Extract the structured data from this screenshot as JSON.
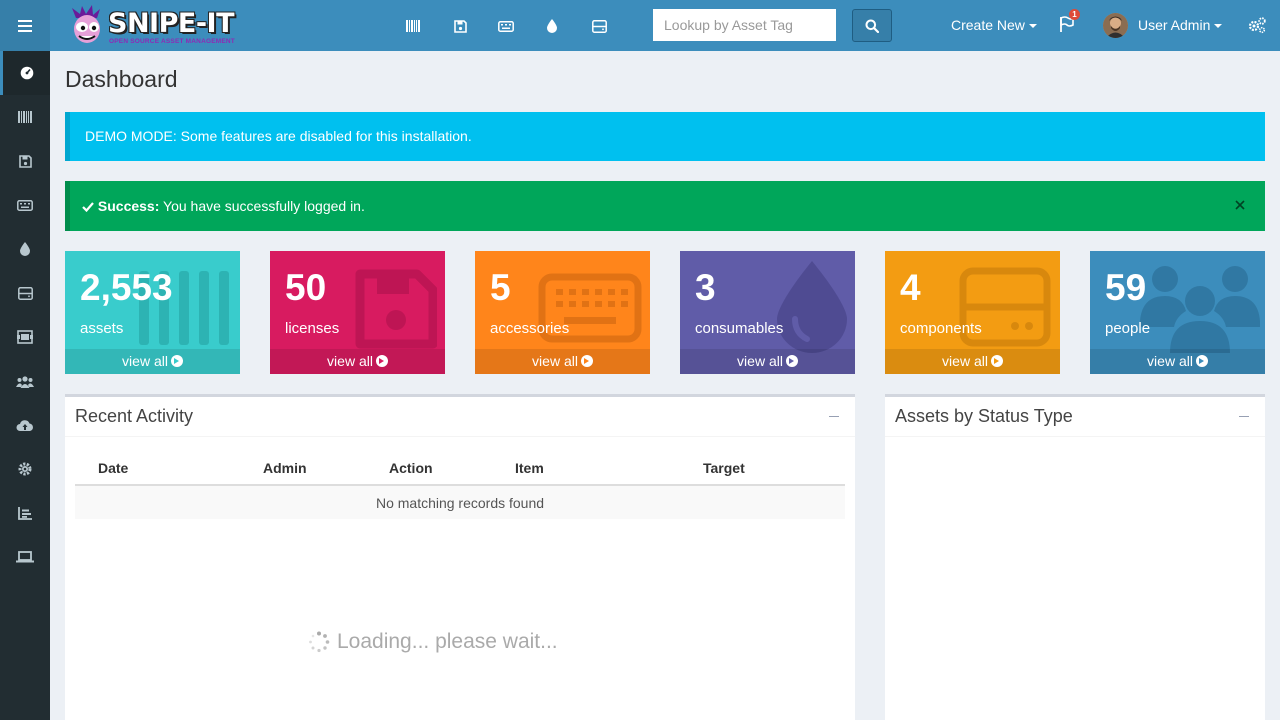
{
  "app": {
    "logo_text": "SNIPE-IT",
    "logo_subtitle": "OPEN SOURCE ASSET MANAGEMENT"
  },
  "header": {
    "nav_icons": [
      "barcode-icon",
      "floppy-icon",
      "keyboard-icon",
      "tint-icon",
      "hdd-icon"
    ],
    "search_placeholder": "Lookup by Asset Tag",
    "create_new_label": "Create New",
    "flag_badge": "1",
    "user_name": "User Admin"
  },
  "sidebar": {
    "items": [
      "dashboard-icon",
      "barcode-icon",
      "floppy-icon",
      "keyboard-icon",
      "tint-icon",
      "hdd-icon",
      "kit-icon",
      "people-icon",
      "cloud-upload-icon",
      "gear-icon",
      "report-icon",
      "laptop-icon"
    ]
  },
  "page": {
    "title": "Dashboard"
  },
  "alerts": {
    "info": "DEMO MODE: Some features are disabled for this installation.",
    "success_strong": "Success:",
    "success_text": " You have successfully logged in."
  },
  "tiles": [
    {
      "count": "2,553",
      "label": "assets",
      "link": "view all",
      "color": "#39cccc"
    },
    {
      "count": "50",
      "label": "licenses",
      "link": "view all",
      "color": "#d81b60"
    },
    {
      "count": "5",
      "label": "accessories",
      "link": "view all",
      "color": "#ff851b"
    },
    {
      "count": "3",
      "label": "consumables",
      "link": "view all",
      "color": "#605ca8"
    },
    {
      "count": "4",
      "label": "components",
      "link": "view all",
      "color": "#f39c12"
    },
    {
      "count": "59",
      "label": "people",
      "link": "view all",
      "color": "#3c8dbc"
    }
  ],
  "recent_activity": {
    "title": "Recent Activity",
    "columns": [
      "Date",
      "Admin",
      "Action",
      "Item",
      "Target"
    ],
    "empty_text": "No matching records found",
    "loading_text": "Loading... please wait..."
  },
  "status_box": {
    "title": "Assets by Status Type"
  }
}
